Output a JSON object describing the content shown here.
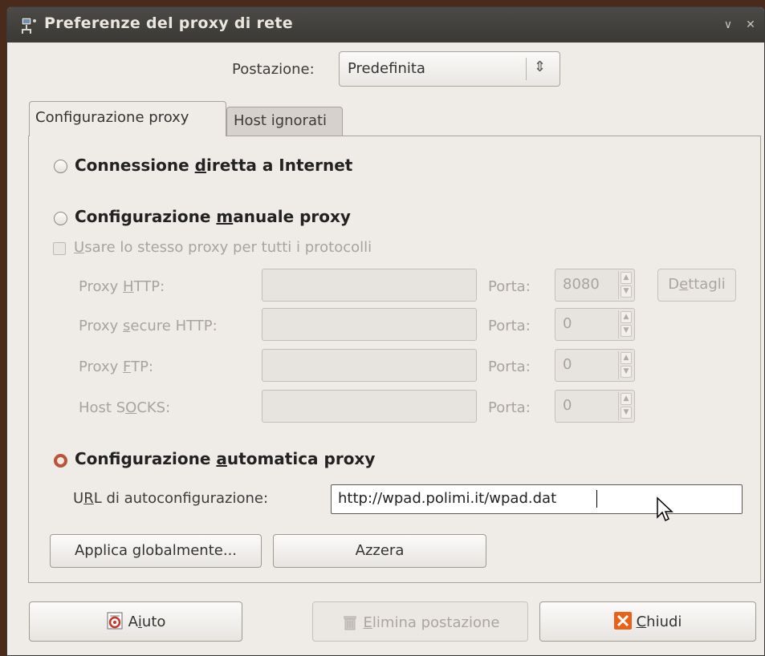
{
  "window": {
    "title": "Preferenze del proxy di rete",
    "icons": {
      "app": "network-proxy-icon",
      "minimize": "chevron-down-icon",
      "close": "close-icon"
    }
  },
  "location": {
    "label": "Postazione:",
    "value": "Predefinita"
  },
  "tabs": [
    {
      "label": "Configurazione proxy",
      "active": true
    },
    {
      "label": "Host ignorati",
      "active": false
    }
  ],
  "options": {
    "direct": {
      "pre": "Connessione ",
      "key": "d",
      "post": "iretta a Internet",
      "selected": false
    },
    "manual": {
      "pre": "Configurazione ",
      "key": "m",
      "post": "anuale proxy",
      "selected": false
    },
    "auto": {
      "pre": "Configurazione ",
      "key": "a",
      "post": "utomatica proxy",
      "selected": true
    }
  },
  "same_proxy": {
    "key": "U",
    "post": "sare lo stesso proxy per tutti i protocolli",
    "checked": false
  },
  "proxies": [
    {
      "pre": "Proxy ",
      "key": "H",
      "post": "TTP:",
      "host": "",
      "port_label": "Porta:",
      "port": "8080"
    },
    {
      "pre": "Proxy ",
      "key": "s",
      "post": "ecure HTTP:",
      "host": "",
      "port_label": "Porta:",
      "port": "0"
    },
    {
      "pre": "Proxy ",
      "key": "F",
      "post": "TP:",
      "host": "",
      "port_label": "Porta:",
      "port": "0"
    },
    {
      "pre": "Host S",
      "key": "O",
      "post": "CKS:",
      "host": "",
      "port_label": "Porta:",
      "port": "0"
    }
  ],
  "details_button": {
    "pre": "D",
    "key": "e",
    "post": "ttagli"
  },
  "autoconfig": {
    "pre": "U",
    "key": "R",
    "post": "L di autoconfigurazione:",
    "url": "http://wpad.polimi.it/wpad.dat"
  },
  "buttons": {
    "apply": "Applica globalmente...",
    "reset": "Azzera",
    "help": {
      "pre": "A",
      "key": "i",
      "post": "uto"
    },
    "delete": {
      "pre": "",
      "key": "E",
      "post": "limina postazione"
    },
    "close": {
      "pre": "",
      "key": "C",
      "post": "hiudi"
    }
  }
}
